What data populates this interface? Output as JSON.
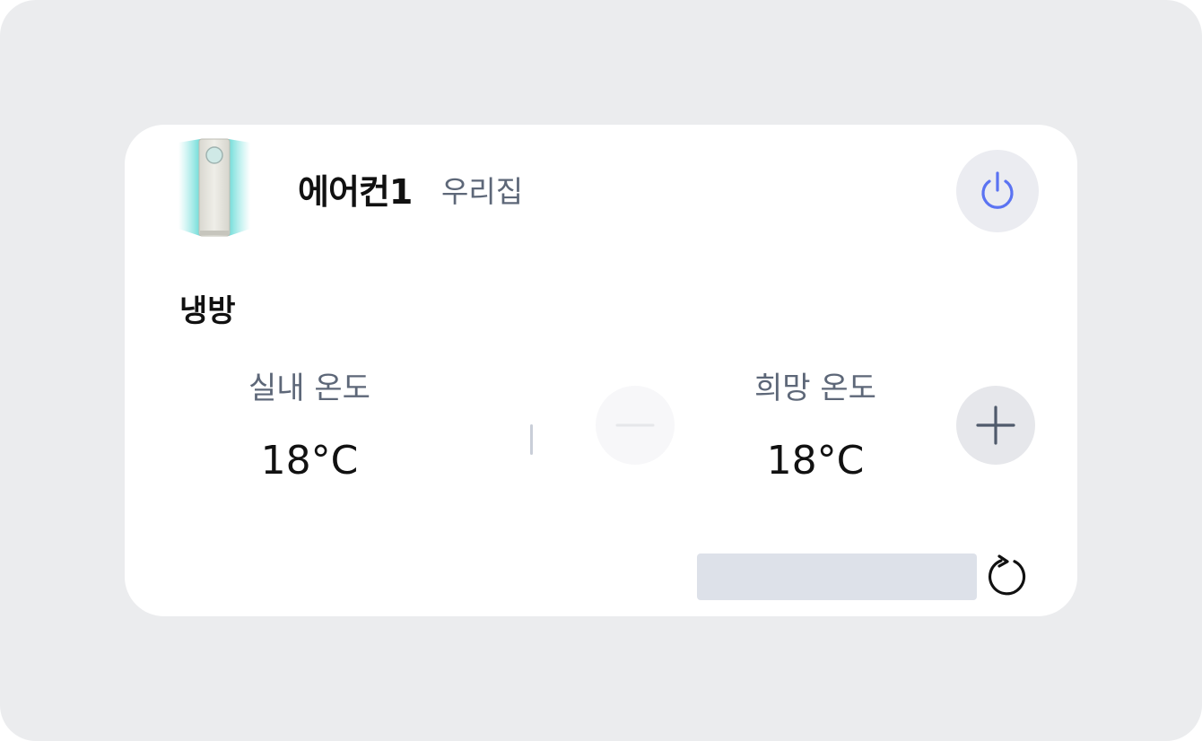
{
  "device": {
    "name": "에어컨1",
    "location": "우리집",
    "image_icon": "air-conditioner-icon"
  },
  "power": {
    "icon": "power-icon",
    "accent_color": "#5b73f2"
  },
  "mode": {
    "label": "냉방"
  },
  "indoor": {
    "label": "실내 온도",
    "value": "18°C"
  },
  "target": {
    "label": "희망 온도",
    "value": "18°C",
    "decrease_icon": "minus-icon",
    "increase_icon": "plus-icon"
  },
  "footer": {
    "refresh_icon": "refresh-icon"
  }
}
